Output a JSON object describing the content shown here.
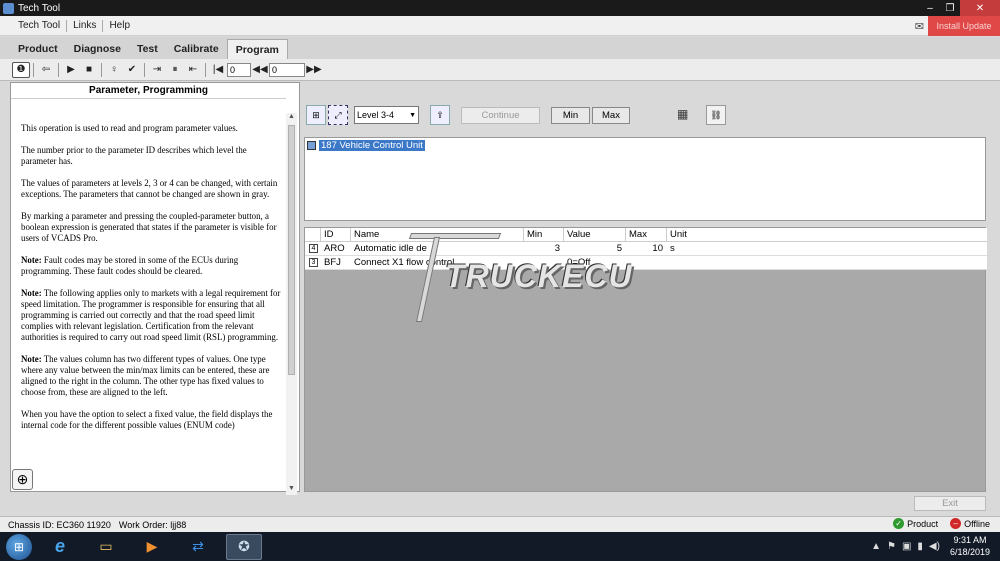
{
  "window": {
    "title": "Tech Tool",
    "minimize_glyph": "–",
    "maximize_glyph": "❐",
    "close_glyph": "✕"
  },
  "menu": {
    "items": [
      "Tech Tool",
      "Links",
      "Help"
    ],
    "red_button": "Install Update",
    "mail_icon_glyph": "✉"
  },
  "tabs": {
    "items": [
      "Product",
      "Diagnose",
      "Test",
      "Calibrate",
      "Program"
    ],
    "active_index": 4
  },
  "toolbar": {
    "info_glyph": "❶",
    "back_glyph": "⇦",
    "play_glyph": "▶",
    "stop_glyph": "■",
    "record_glyph": "♀",
    "check_glyph": "✔",
    "step_glyph": "⇥",
    "pause_glyph": "⏸",
    "stepback_glyph": "⇤",
    "first_glyph": "|◀",
    "input1_value": "0",
    "rewind_glyph": "◀◀",
    "input2_value": "0",
    "forward_glyph": "▶▶"
  },
  "info_panel": {
    "heading": "Parameter, Programming",
    "paragraphs": [
      {
        "bold": "",
        "text": "This operation is used to read and program parameter values."
      },
      {
        "bold": "",
        "text": "The number prior to the parameter ID describes which level the parameter has."
      },
      {
        "bold": "",
        "text": "The values of parameters at levels 2, 3 or 4 can be changed, with certain exceptions. The parameters that cannot be changed are shown in gray."
      },
      {
        "bold": "",
        "text": "By marking a parameter and pressing the coupled-parameter button, a boolean expression is generated that states if the parameter is visible for users of VCADS Pro."
      },
      {
        "bold": "Note:",
        "text": " Fault codes may be stored in some of the ECUs during programming. These fault codes should be cleared."
      },
      {
        "bold": "Note:",
        "text": " The following applies only to markets with a legal requirement for speed limitation. The programmer is responsible for ensuring that all programming is carried out correctly and that the road speed limit complies with relevant legislation. Certification from the relevant authorities is required to carry out road speed limit (RSL) programming."
      },
      {
        "bold": "Note:",
        "text": " The values column has two different types of values. One type where any value between the min/max limits can be entered, these are aligned to the right in the column. The other type has fixed values to choose from, these are aligned to the left."
      },
      {
        "bold": "",
        "text": "When you have the option to select a fixed value, the field displays the internal code for the different possible values (ENUM code)"
      }
    ],
    "zoom_glyph": "⊕"
  },
  "program_toolbar": {
    "tree_icon_glyph": "⊞",
    "expand_icon_glyph": "⤢",
    "level_value": "Level 3-4",
    "caret_glyph": "▼",
    "export_icon_glyph": "⇪",
    "continue_label": "Continue",
    "min_label": "Min",
    "max_label": "Max",
    "calculator_glyph": "▦",
    "link_glyph": "⛓"
  },
  "ecu_list": {
    "items": [
      {
        "label": "187  Vehicle Control Unit"
      }
    ]
  },
  "parameter_grid": {
    "columns": [
      "ID",
      "Name",
      "Min",
      "Value",
      "Max",
      "Unit"
    ],
    "rows": [
      {
        "level": "4",
        "id": "ARO",
        "name": "Automatic idle de",
        "min": "3",
        "value": "5",
        "max": "10",
        "unit": "s"
      },
      {
        "level": "3",
        "id": "BFJ",
        "name": "Connect X1 flow control",
        "min": "",
        "value": "0=Off",
        "max": "",
        "unit": ""
      }
    ]
  },
  "watermark": {
    "text": "TRUCKECU"
  },
  "footer": {
    "exit_label": "Exit",
    "chassis_id": "Chassis ID: EC360 11920",
    "work_order": "Work Order: ljj88",
    "product_status": "Product",
    "offline_status": "Offline",
    "product_glyph": "✓",
    "offline_glyph": "–"
  },
  "taskbar": {
    "start_glyph": "⊞",
    "ie_glyph": "e",
    "explorer_glyph": "▭",
    "media_glyph": "▶",
    "teamviewer_glyph": "⇄",
    "techtool_glyph": "✪",
    "tray_glyphs": [
      "▲",
      "⚑",
      "▣",
      "▮",
      "◀)"
    ],
    "time": "9:31 AM",
    "date": "6/18/2019"
  },
  "colors": {
    "selection_blue": "#3c78c8",
    "grid_background": "#a9a9a9",
    "close_red": "#c43c3c",
    "status_green": "#2f9a2f",
    "status_red": "#d02828"
  }
}
